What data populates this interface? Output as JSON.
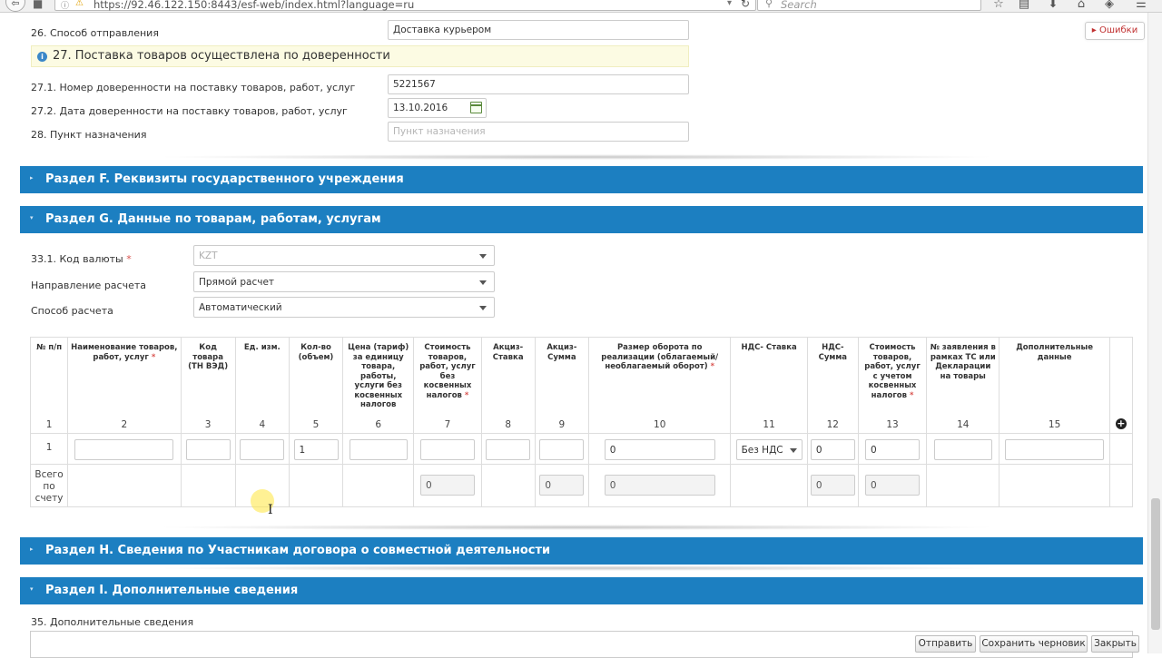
{
  "browser": {
    "url": "https://92.46.122.150:8443/esf-web/index.html?language=ru",
    "search_placeholder": "Search",
    "back_glyph": "⇦",
    "stop_glyph": "■",
    "info_glyph": "ⓘ",
    "warn_glyph": "⚠",
    "dropdown_glyph": "▾",
    "reload_glyph": "↻",
    "search_glyph": "⚲",
    "tools": [
      {
        "name": "bookmark-star-icon",
        "glyph": "☆"
      },
      {
        "name": "reading-list-icon",
        "glyph": "▤"
      },
      {
        "name": "download-icon",
        "glyph": "⬇"
      },
      {
        "name": "home-icon",
        "glyph": "⌂"
      },
      {
        "name": "pocket-icon",
        "glyph": "◈"
      },
      {
        "name": "menu-icon",
        "glyph": "☰"
      }
    ]
  },
  "errors_button": "▸ Ошибки",
  "section_e": {
    "field26": {
      "label": "26. Способ отправления",
      "value": "Доставка курьером"
    },
    "info27": {
      "icon": "i",
      "text": "27. Поставка товаров осуществлена по доверенности"
    },
    "field27_1": {
      "label": "27.1. Номер доверенности на поставку товаров, работ, услуг",
      "value": "5221567"
    },
    "field27_2": {
      "label": "27.2. Дата доверенности на поставку товаров, работ, услуг",
      "value": "13.10.2016"
    },
    "field28": {
      "label": "28. Пункт назначения",
      "placeholder": "Пункт назначения"
    }
  },
  "sections": {
    "f": {
      "caret": "▸",
      "title": "Раздел F. Реквизиты государственного учреждения"
    },
    "g": {
      "caret": "▾",
      "title": "Раздел G. Данные по товарам, работам, услугам"
    },
    "h": {
      "caret": "▸",
      "title": "Раздел H. Сведения по Участникам договора о совместной деятельности"
    },
    "i": {
      "caret": "▾",
      "title": "Раздел I. Дополнительные сведения"
    }
  },
  "section_g": {
    "currency": {
      "label": "33.1. Код валюты",
      "required_mark": "*",
      "value": "KZT"
    },
    "direction": {
      "label": "Направление расчета",
      "value": "Прямой расчет"
    },
    "method": {
      "label": "Способ расчета",
      "value": "Автоматический"
    },
    "table": {
      "headers": [
        {
          "text": "№ п/п",
          "req": "",
          "num": "1"
        },
        {
          "text": "Наименование товаров, работ, услуг",
          "req": "*",
          "num": "2"
        },
        {
          "text": "Код товара (ТН ВЭД)",
          "req": "",
          "num": "3"
        },
        {
          "text": "Ед. изм.",
          "req": "",
          "num": "4"
        },
        {
          "text": "Кол-во (объем)",
          "req": "",
          "num": "5"
        },
        {
          "text": "Цена (тариф) за единицу товара, работы, услуги без косвенных налогов",
          "req": "",
          "num": "6"
        },
        {
          "text": "Стоимость товаров, работ, услуг без косвенных налогов",
          "req": "*",
          "num": "7"
        },
        {
          "text": "Акциз- Ставка",
          "req": "",
          "num": "8"
        },
        {
          "text": "Акциз- Сумма",
          "req": "",
          "num": "9"
        },
        {
          "text": "Размер оборота по реализации (облагаемый/необлагаемый оборот)",
          "req": "*",
          "num": "10"
        },
        {
          "text": "НДС- Ставка",
          "req": "",
          "num": "11"
        },
        {
          "text": "НДС- Сумма",
          "req": "",
          "num": "12"
        },
        {
          "text": "Стоимость товаров, работ, услуг с учетом косвенных налогов",
          "req": "*",
          "num": "13"
        },
        {
          "text": "№ заявления в рамках ТС или Декларации на товары",
          "req": "",
          "num": "14"
        },
        {
          "text": "Дополнительные данные",
          "req": "",
          "num": "15"
        }
      ],
      "add_icon": "+",
      "row1": {
        "num": "1",
        "c2": "",
        "c3": "",
        "c4": "",
        "c5": "1",
        "c6": "",
        "c7": "",
        "c8": "",
        "c9": "",
        "c10": "0",
        "c11": "Без НДС",
        "c12": "0",
        "c13": "0",
        "c14": "",
        "c15": ""
      },
      "total": {
        "label": "Всего по счету",
        "c7": "0",
        "c9": "0",
        "c10": "0",
        "c12": "0",
        "c13": "0"
      }
    }
  },
  "section_i": {
    "field35": {
      "label": "35. Дополнительные сведения"
    }
  },
  "actions": {
    "send": "Отправить",
    "save_draft": "Сохранить черновик",
    "close": "Закрыть"
  }
}
